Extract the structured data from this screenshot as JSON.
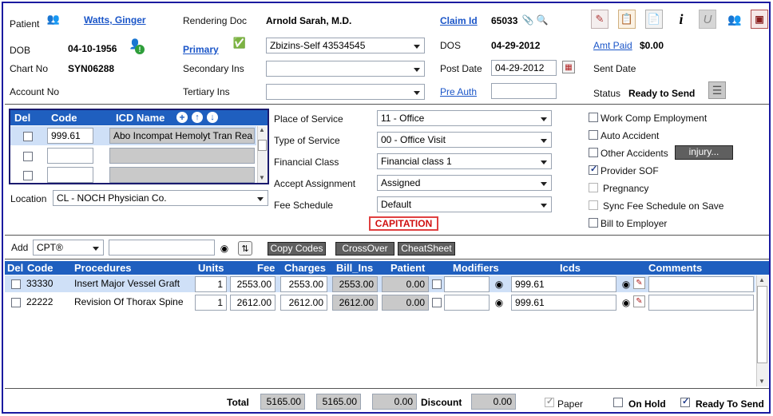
{
  "header": {
    "patient_label": "Patient",
    "patient_name": "Watts, Ginger",
    "rendering_doc_label": "Rendering Doc",
    "rendering_doc": "Arnold Sarah, M.D.",
    "claim_id_label": "Claim Id",
    "claim_id": "65033",
    "dob_label": "DOB",
    "dob": "04-10-1956",
    "primary_label": "Primary",
    "primary_ins": "Zbizins-Self 43534545",
    "dos_label": "DOS",
    "dos": "04-29-2012",
    "amt_paid_label": "Amt Paid",
    "amt_paid": "$0.00",
    "chart_no_label": "Chart No",
    "chart_no": "SYN06288",
    "secondary_label": "Secondary Ins",
    "secondary_ins": "",
    "post_date_label": "Post Date",
    "post_date": "04-29-2012",
    "sent_date_label": "Sent Date",
    "account_label": "Account No",
    "tertiary_label": "Tertiary Ins",
    "tertiary_ins": "",
    "pre_auth_label": "Pre Auth",
    "pre_auth": "",
    "status_label": "Status",
    "status": "Ready to Send"
  },
  "icd": {
    "del_header": "Del",
    "code_header": "Code",
    "name_header": "ICD Name",
    "rows": [
      {
        "code": "999.61",
        "name": "Abo Incompat Hemolyt Tran Rea"
      },
      {
        "code": "",
        "name": ""
      },
      {
        "code": "",
        "name": ""
      }
    ],
    "location_label": "Location",
    "location": "CL - NOCH Physician Co."
  },
  "service": {
    "pos_label": "Place of Service",
    "pos": "11 - Office",
    "type_label": "Type of Service",
    "type": "00 - Office Visit",
    "fin_label": "Financial Class",
    "fin": "Financial class 1",
    "accept_label": "Accept Assignment",
    "accept": "Assigned",
    "fee_label": "Fee Schedule",
    "fee": "Default",
    "capitation": "CAPITATION"
  },
  "flags": {
    "work_comp": "Work Comp Employment",
    "auto_accident": "Auto Accident",
    "other_accidents": "Other Accidents",
    "injury_button": "injury...",
    "provider_sof": "Provider SOF",
    "pregnancy": "Pregnancy",
    "sync_fee": "Sync Fee Schedule on Save",
    "bill_employer": "Bill to Employer"
  },
  "toolbar": {
    "add_label": "Add",
    "add_type": "CPT®",
    "search_value": "",
    "copy_codes": "Copy Codes",
    "crossover": "CrossOver",
    "cheatsheet": "CheatSheet"
  },
  "procedures": {
    "headers": {
      "del": "Del",
      "code": "Code",
      "procedures": "Procedures",
      "units": "Units",
      "fee": "Fee",
      "charges": "Charges",
      "bill_ins": "Bill_Ins",
      "patient": "Patient",
      "modifiers": "Modifiers",
      "icds": "Icds",
      "comments": "Comments"
    },
    "rows": [
      {
        "code": "33330",
        "procedure": "Insert Major Vessel Graft",
        "units": "1",
        "fee": "2553.00",
        "charges": "2553.00",
        "bill_ins": "2553.00",
        "patient": "0.00",
        "modifier": "",
        "icds": "999.61",
        "comment": ""
      },
      {
        "code": "22222",
        "procedure": "Revision Of Thorax Spine",
        "units": "1",
        "fee": "2612.00",
        "charges": "2612.00",
        "bill_ins": "2612.00",
        "patient": "0.00",
        "modifier": "",
        "icds": "999.61",
        "comment": ""
      }
    ]
  },
  "footer": {
    "total_label": "Total",
    "total_charges": "5165.00",
    "total_bill_ins": "5165.00",
    "total_patient": "0.00",
    "discount_label": "Discount",
    "discount": "0.00",
    "paper_label": "Paper",
    "on_hold_label": "On Hold",
    "ready_label": "Ready To Send"
  },
  "colors": {
    "grid_header": "#1f5fbf",
    "selected_row": "#cfe0f7",
    "link": "#1a55c8",
    "capitation": "#d01010"
  }
}
